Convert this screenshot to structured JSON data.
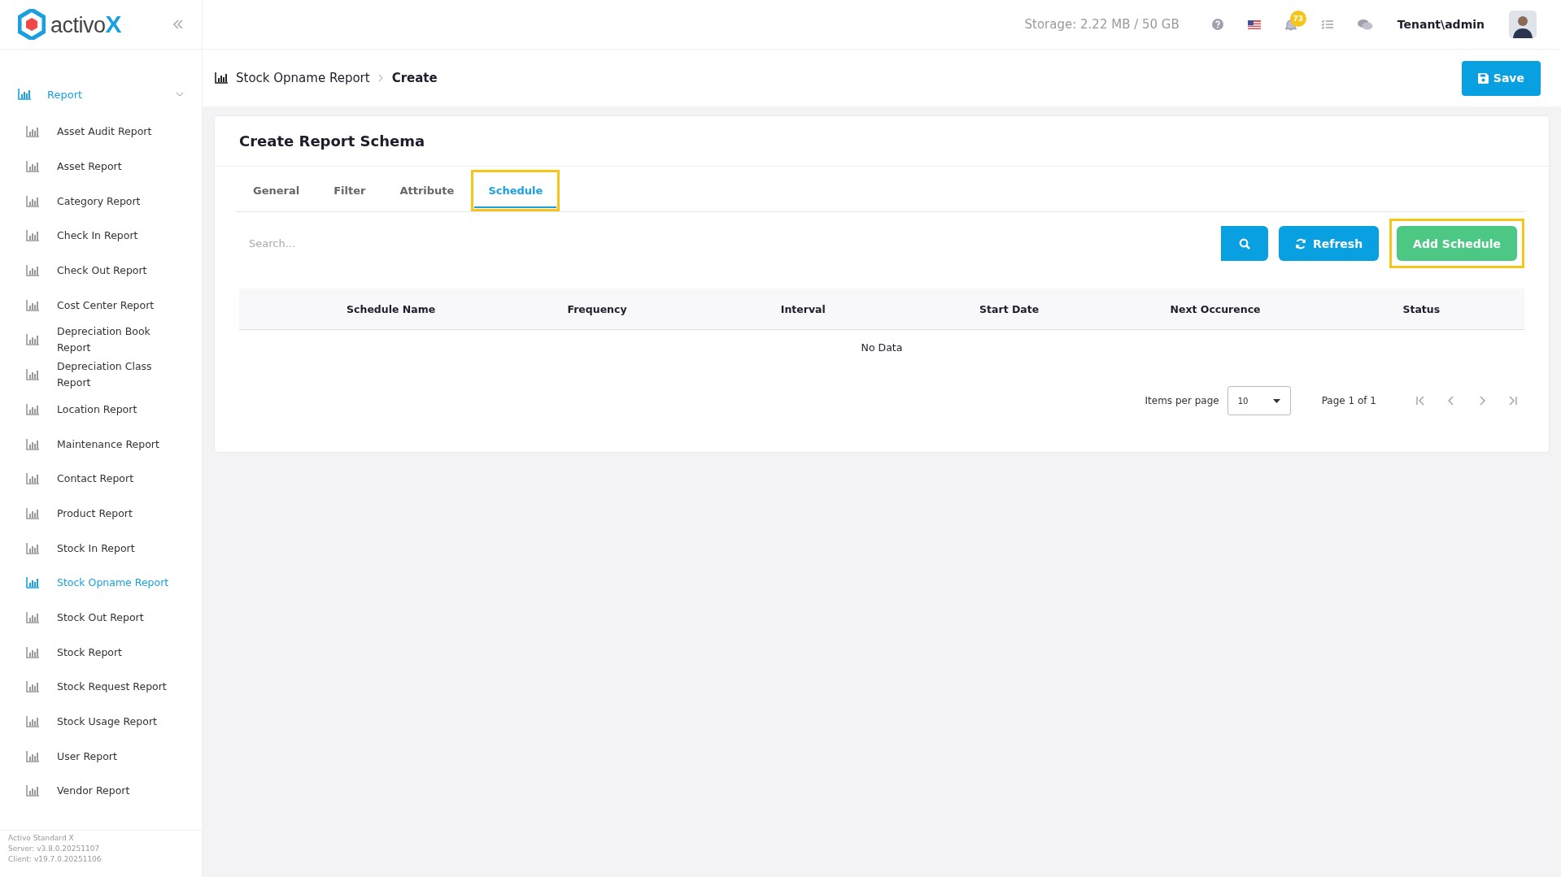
{
  "logo": "activo**X**",
  "header": {
    "storage": "Storage: 2.22 MB / 50 GB",
    "notification_count": "73",
    "user": "Tenant\\admin"
  },
  "sidebar": {
    "group": {
      "label": "Report",
      "expanded": true
    },
    "items": [
      {
        "label": "Asset Audit Report",
        "selected": false
      },
      {
        "label": "Asset Report",
        "selected": false
      },
      {
        "label": "Category Report",
        "selected": false
      },
      {
        "label": "Check In Report",
        "selected": false
      },
      {
        "label": "Check Out Report",
        "selected": false
      },
      {
        "label": "Cost Center Report",
        "selected": false
      },
      {
        "label": "Depreciation Book Report",
        "selected": false
      },
      {
        "label": "Depreciation Class Report",
        "selected": false
      },
      {
        "label": "Location Report",
        "selected": false
      },
      {
        "label": "Maintenance Report",
        "selected": false
      },
      {
        "label": "Contact Report",
        "selected": false
      },
      {
        "label": "Product Report",
        "selected": false
      },
      {
        "label": "Stock In Report",
        "selected": false
      },
      {
        "label": "Stock Opname Report",
        "selected": true
      },
      {
        "label": "Stock Out Report",
        "selected": false
      },
      {
        "label": "Stock Report",
        "selected": false
      },
      {
        "label": "Stock Request Report",
        "selected": false
      },
      {
        "label": "Stock Usage Report",
        "selected": false
      },
      {
        "label": "User Report",
        "selected": false
      },
      {
        "label": "Vendor Report",
        "selected": false
      }
    ],
    "footer": [
      "Activo Standard X",
      "Server: v3.8.0.20251107",
      "Client: v19.7.0.20251106"
    ]
  },
  "breadcrumb": [
    "Stock Opname Report",
    "Create"
  ],
  "save_button": "Save",
  "card": {
    "title": "Create Report Schema",
    "tabs": [
      {
        "label": "General",
        "selected": false,
        "highlighted": false
      },
      {
        "label": "Filter",
        "selected": false,
        "highlighted": false
      },
      {
        "label": "Attribute",
        "selected": false,
        "highlighted": false
      },
      {
        "label": "Schedule",
        "selected": true,
        "highlighted": true
      }
    ],
    "search": {
      "placeholder": "Search..."
    },
    "buttons": [
      {
        "label": "Refresh",
        "kind": "refresh",
        "highlighted": false
      },
      {
        "label": "Add Schedule",
        "kind": "add",
        "highlighted": true
      }
    ],
    "table": {
      "columns": [
        "Schedule Name",
        "Frequency",
        "Interval",
        "Start Date",
        "Next Occurence",
        "Status"
      ],
      "empty": "No Data"
    },
    "pagination": {
      "label": "Items per page",
      "page_size": "10",
      "page": "Page 1 of 1"
    }
  }
}
